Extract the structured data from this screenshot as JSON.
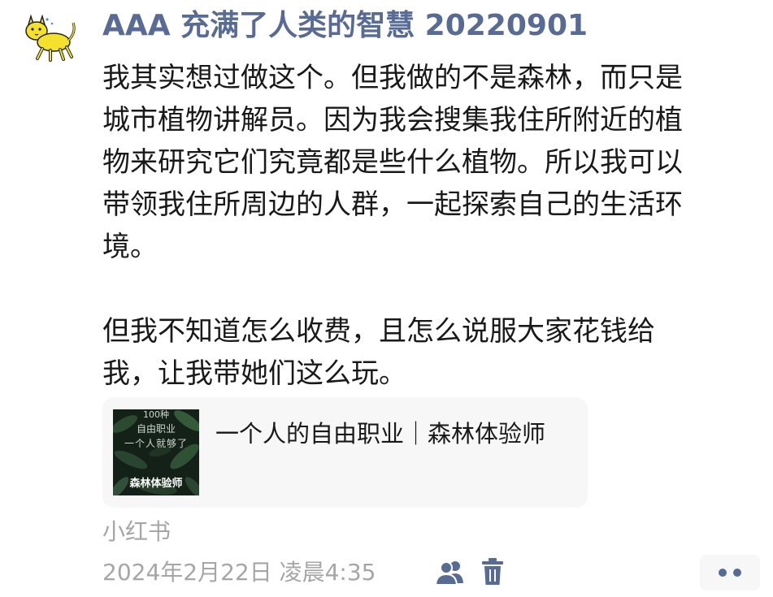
{
  "post": {
    "username": "AAA 充满了人类的智慧 20220901",
    "avatar_icon": "yellow-cat-avatar-icon",
    "body_lines": [
      "我其实想过做这个。但我做的不是森林，而只是",
      "城市植物讲解员。因为我会搜集我住所附近的植",
      "物来研究它们究竟都是些什么植物。所以我可以",
      "带领我住所周边的人群，一起探索自己的生活环",
      "境。",
      "但我不知道怎么收费，且怎么说服大家花钱给",
      "我，让我带她们这么玩。"
    ]
  },
  "link_card": {
    "thumbnail_lines": [
      "100种",
      "自由职业",
      "一个人就够了"
    ],
    "thumbnail_caption": "森林体验师",
    "title": "一个人的自由职业｜森林体验师"
  },
  "footer": {
    "source": "小红书",
    "timestamp": "2024年2月22日 凌晨4:35",
    "people_icon": "visibility-people-icon",
    "trash_icon": "trash-icon",
    "more_icon": "more-dots-icon"
  },
  "colors": {
    "username": "#576b95",
    "body_text": "#191919",
    "meta_text": "#a6a6a6",
    "card_background": "#f7f7f7",
    "icon": "#576b95"
  }
}
